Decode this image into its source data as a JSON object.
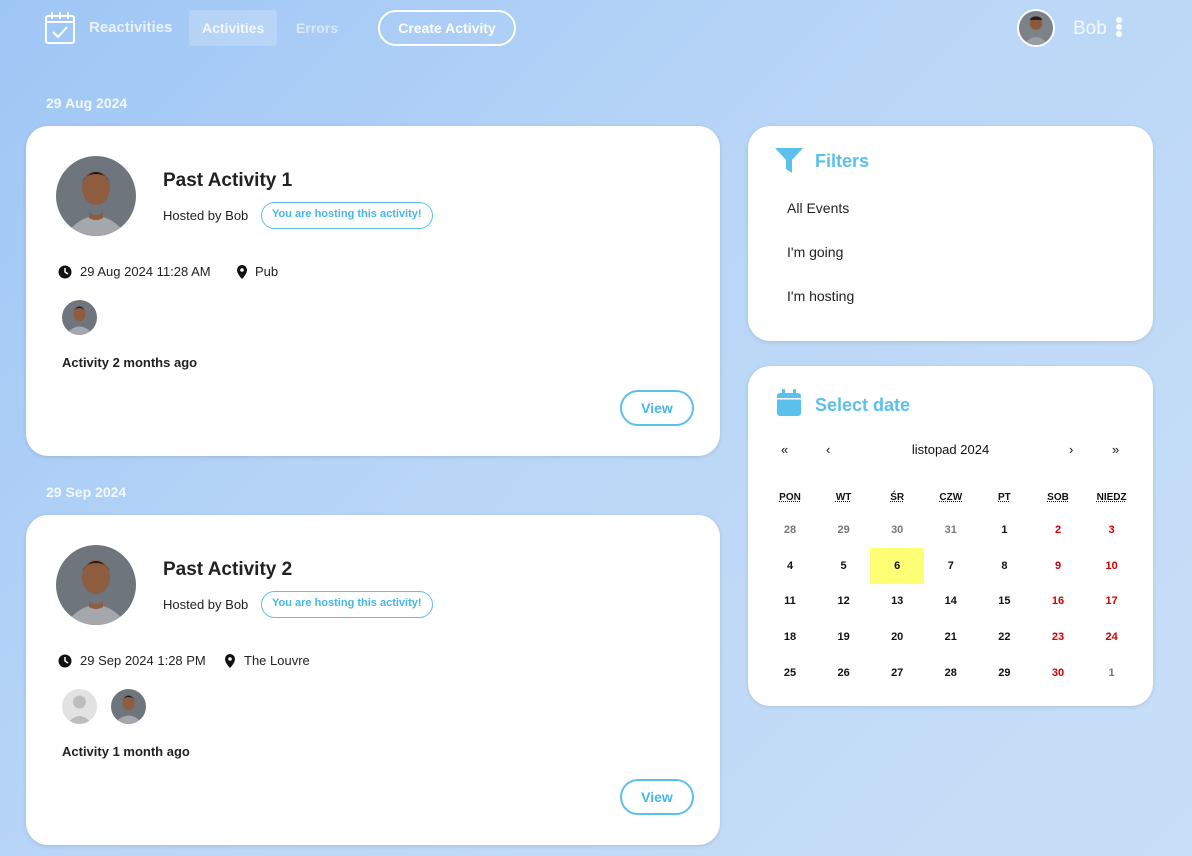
{
  "nav": {
    "brand": "Reactivities",
    "activities": "Activities",
    "errors": "Errors",
    "create": "Create Activity",
    "user": "Bob"
  },
  "groups": [
    {
      "date": "29 Aug 2024",
      "title": "Past Activity 1",
      "hosted_by": "Hosted by Bob",
      "badge": "You are hosting this activity!",
      "datetime": "29 Aug 2024 11:28 AM",
      "venue": "Pub",
      "ago": "Activity 2 months ago",
      "view": "View"
    },
    {
      "date": "29 Sep 2024",
      "title": "Past Activity 2",
      "hosted_by": "Hosted by Bob",
      "badge": "You are hosting this activity!",
      "datetime": "29 Sep 2024 1:28 PM",
      "venue": "The Louvre",
      "ago": "Activity 1 month ago",
      "view": "View"
    }
  ],
  "filters": {
    "title": "Filters",
    "items": [
      "All Events",
      "I'm going",
      "I'm hosting"
    ]
  },
  "calendar": {
    "title": "Select date",
    "month": "listopad 2024",
    "prev2": "«",
    "prev": "‹",
    "next": "›",
    "next2": "»",
    "weekdays": [
      "PON",
      "WT",
      "ŚR",
      "CZW",
      "PT",
      "SOB",
      "NIEDZ"
    ],
    "weeks": [
      [
        "28",
        "29",
        "30",
        "31",
        "1",
        "2",
        "3"
      ],
      [
        "4",
        "5",
        "6",
        "7",
        "8",
        "9",
        "10"
      ],
      [
        "11",
        "12",
        "13",
        "14",
        "15",
        "16",
        "17"
      ],
      [
        "18",
        "19",
        "20",
        "21",
        "22",
        "23",
        "24"
      ],
      [
        "25",
        "26",
        "27",
        "28",
        "29",
        "30",
        "1"
      ]
    ],
    "today": "6"
  },
  "colors": {
    "accent": "#5bc0eb",
    "weekend": "#d10000",
    "today": "#ffff76"
  }
}
